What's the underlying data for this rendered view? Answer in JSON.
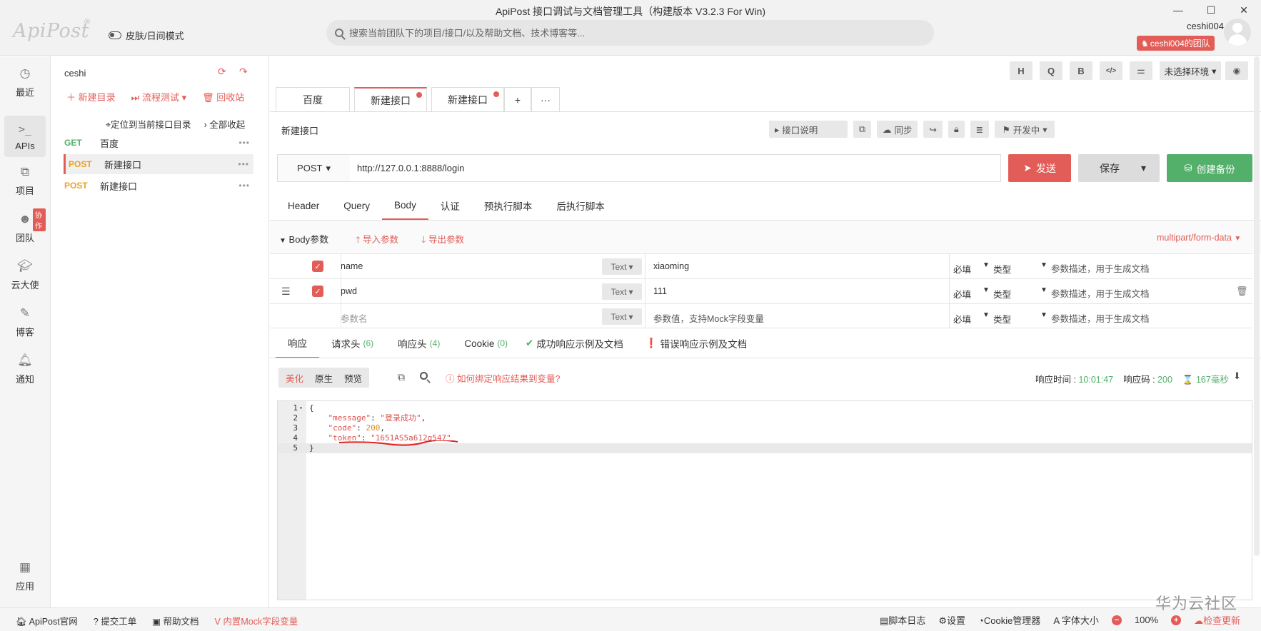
{
  "window": {
    "title": "ApiPost 接口调试与文档管理工具（构建版本 V3.2.3 For Win)",
    "logo": "ApiPost",
    "logo_mark": "®",
    "theme_toggle": "皮肤/日间模式",
    "search_placeholder": "搜索当前团队下的项目/接口/以及帮助文档、技术博客等...",
    "username": "ceshi004",
    "team_badge": "ceshi004的团队",
    "controls": {
      "minimize": "—",
      "maximize": "☐",
      "close": "✕"
    }
  },
  "leftnav": [
    {
      "label": "最近",
      "icon": "clock-icon"
    },
    {
      "label": "APIs",
      "icon": "terminal-icon"
    },
    {
      "label": "项目",
      "icon": "project-icon"
    },
    {
      "label": "团队",
      "icon": "team-icon",
      "badge": "协作"
    },
    {
      "label": "云大使",
      "icon": "graduation-cap-icon"
    },
    {
      "label": "博客",
      "icon": "edit-icon"
    },
    {
      "label": "通知",
      "icon": "bell-icon"
    },
    {
      "label": "应用",
      "icon": "apps-grid-icon"
    }
  ],
  "tree": {
    "project": "ceshi",
    "actions": {
      "new_dir": "新建目录",
      "flow_test": "流程测试",
      "recycle": "回收站"
    },
    "locate": "定位到当前接口目录",
    "collapse": "全部收起",
    "apis": [
      {
        "method": "GET",
        "name": "百度"
      },
      {
        "method": "POST",
        "name": "新建接口"
      },
      {
        "method": "POST",
        "name": "新建接口"
      }
    ]
  },
  "toolbar": {
    "buttons": [
      "H",
      "Q",
      "B",
      "</>",
      "⚌"
    ],
    "env": "未选择环境",
    "eye": "◉"
  },
  "tabs": [
    {
      "label": "百度",
      "dot": false
    },
    {
      "label": "新建接口",
      "dot": true
    },
    {
      "label": "新建接口",
      "dot": true
    }
  ],
  "tab_add": "+",
  "tab_more": "···",
  "api": {
    "title": "新建接口",
    "doc_btn": "接口说明",
    "sync_btn": "同步",
    "status": "开发中",
    "method": "POST",
    "url": "http://127.0.0.1:8888/login",
    "send": "发送",
    "save": "保存",
    "backup": "创建备份"
  },
  "req_tabs": [
    "Header",
    "Query",
    "Body",
    "认证",
    "预执行脚本",
    "后执行脚本"
  ],
  "body": {
    "label": "Body参数",
    "import": "导入参数",
    "export": "导出参数",
    "content_type": "multipart/form-data",
    "params": [
      {
        "name": "name",
        "type": "Text",
        "value": "xiaoming",
        "required": "必填",
        "kind": "类型",
        "desc": "参数描述，用于生成文档"
      },
      {
        "name": "pwd",
        "type": "Text",
        "value": "111",
        "required": "必填",
        "kind": "类型",
        "desc": "参数描述，用于生成文档"
      }
    ],
    "placeholder": {
      "name": "参数名",
      "type": "Text",
      "value": "参数值，支持Mock字段变量",
      "required": "必填",
      "kind": "类型",
      "desc": "参数描述，用于生成文档"
    }
  },
  "resp_tabs": [
    {
      "label": "响应",
      "count": ""
    },
    {
      "label": "请求头",
      "count": "(6)"
    },
    {
      "label": "响应头",
      "count": "(4)"
    },
    {
      "label": "Cookie",
      "count": "(0)"
    },
    {
      "label": "成功响应示例及文档",
      "count": ""
    },
    {
      "label": "错误响应示例及文档",
      "count": ""
    }
  ],
  "resp": {
    "views": [
      "美化",
      "原生",
      "预览"
    ],
    "bind_help": "如何绑定响应结果到变量?",
    "time_label": "响应时间 :",
    "time": "10:01:47",
    "code_label": "响应码 :",
    "code": "200",
    "duration": "167毫秒",
    "lines": [
      {
        "n": "1",
        "fold": true
      },
      {
        "n": "2",
        "key": "\"message\"",
        "val": "\"登录成功\"",
        "type": "str",
        "comma": ","
      },
      {
        "n": "3",
        "key": "\"code\"",
        "val": "200",
        "type": "num",
        "comma": ","
      },
      {
        "n": "4",
        "key": "\"token\"",
        "val": "\"1651AS5a612q547\"",
        "type": "str",
        "comma": ""
      },
      {
        "n": "5"
      }
    ],
    "open": "{",
    "close": "}"
  },
  "status_bar": {
    "left": [
      "ApiPost官网",
      "提交工单",
      "帮助文档",
      "内置Mock字段变量"
    ],
    "log": "脚本日志",
    "settings": "设置",
    "cookie": "Cookie管理器",
    "font": "字体大小",
    "zoom": "100%",
    "update": "检查更新"
  },
  "watermark": "华为云社区",
  "colors": {
    "accent": "#e25d58",
    "green": "#52b06a",
    "orange": "#f0a11f"
  }
}
